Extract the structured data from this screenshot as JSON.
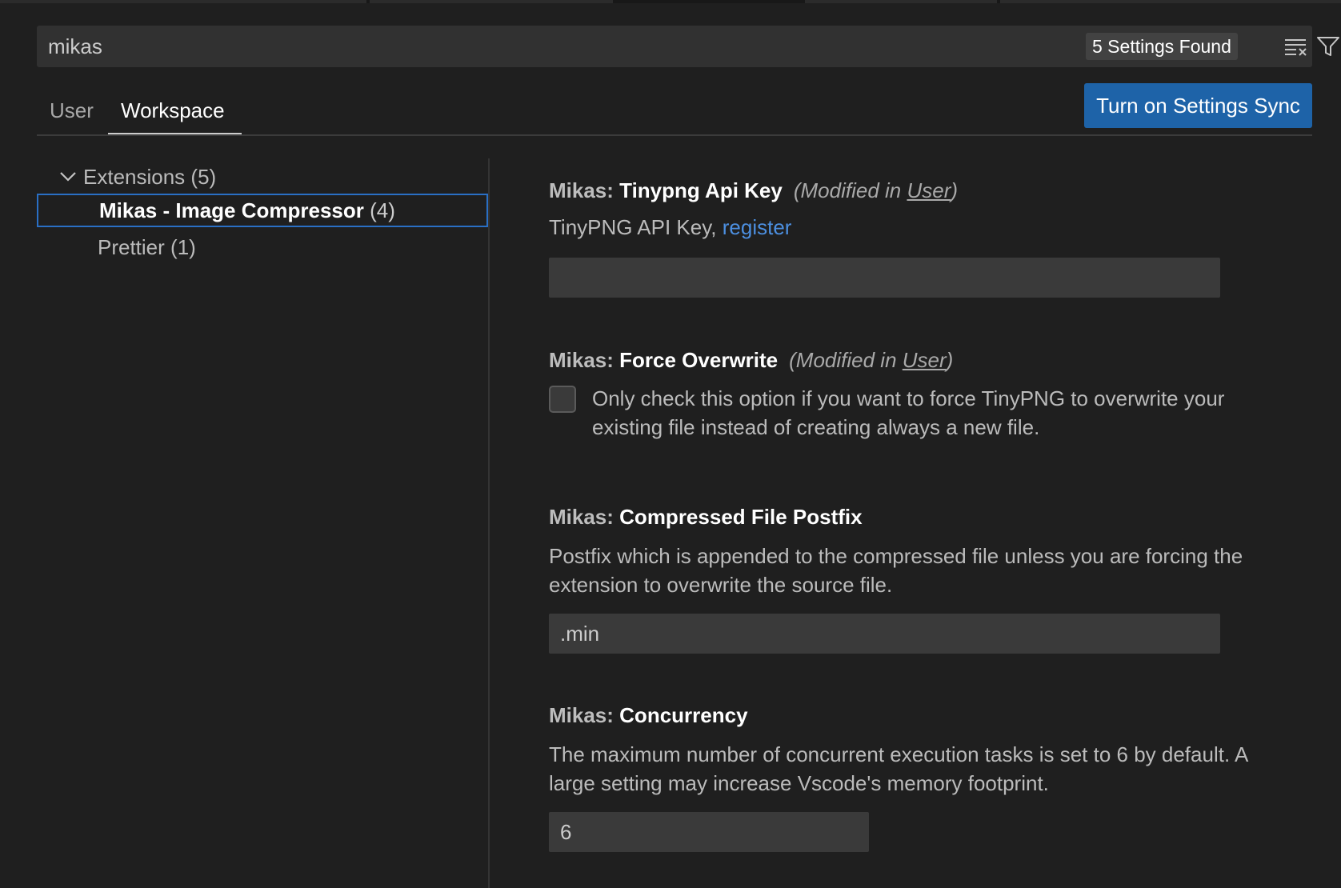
{
  "search": {
    "value": "mikas",
    "results_count": "5 Settings Found"
  },
  "tabs": [
    {
      "label": "User"
    },
    {
      "label": "Workspace"
    }
  ],
  "sync_button": {
    "label": "Turn on Settings Sync"
  },
  "toc": {
    "group": {
      "label": "Extensions",
      "count": "(5)"
    },
    "items": [
      {
        "label": "Mikas - Image Compressor",
        "count": "(4)"
      },
      {
        "label": "Prettier",
        "count": "(1)"
      }
    ]
  },
  "settings": {
    "api_key": {
      "category": "Mikas: ",
      "label": "Tinypng Api Key",
      "modified_prefix": "(Modified in ",
      "modified_link": "User",
      "modified_suffix": ")",
      "description": "TinyPNG API Key, ",
      "description_link": "register",
      "value": ""
    },
    "force_overwrite": {
      "category": "Mikas: ",
      "label": "Force Overwrite",
      "modified_prefix": "(Modified in ",
      "modified_link": "User",
      "modified_suffix": ")",
      "description": "Only check this option if you want to force TinyPNG to overwrite your existing file instead of creating always a new file.",
      "checked": false
    },
    "postfix": {
      "category": "Mikas: ",
      "label": "Compressed File Postfix",
      "description": "Postfix which is appended to the compressed file unless you are forcing the extension to overwrite the source file.",
      "value": ".min"
    },
    "concurrency": {
      "category": "Mikas: ",
      "label": "Concurrency",
      "description": "The maximum number of concurrent execution tasks is set to 6 by default. A large setting may increase Vscode's memory footprint.",
      "value": "6"
    }
  },
  "colors": {
    "background": "#1f1f1f",
    "input_background": "#313131",
    "accent_button": "#1e63a8",
    "link": "#4c8fe0",
    "focus_border": "#2a6fc4"
  },
  "icons": {
    "clear": "clear-filter-icon",
    "filter": "filter-icon",
    "chevron": "chevron-down-icon"
  }
}
